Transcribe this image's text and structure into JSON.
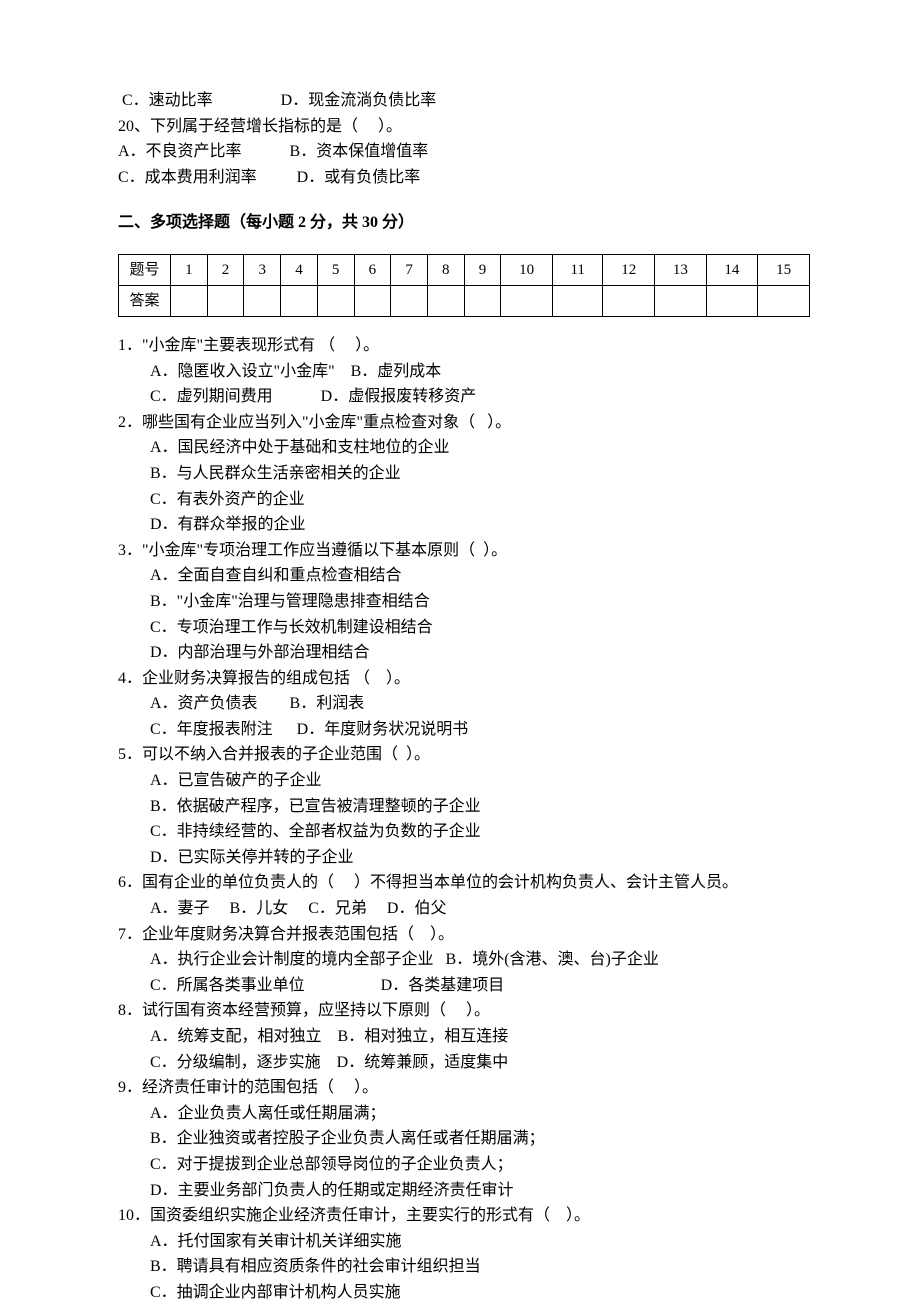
{
  "top": {
    "line1": " C．速动比率                 D．现金流淌负债比率",
    "line2": "20、下列属于经营增长指标的是（     ）。",
    "line3": "A．不良资产比率            B．资本保值增值率",
    "line4": "C．成本费用利润率          D．或有负债比率"
  },
  "section2_title": "二、多项选择题（每小题 2 分，共 30 分）",
  "table": {
    "row_label_1": "题号",
    "row_label_2": "答案",
    "numbers": [
      "1",
      "2",
      "3",
      "4",
      "5",
      "6",
      "7",
      "8",
      "9",
      "10",
      "11",
      "12",
      "13",
      "14",
      "15"
    ]
  },
  "q1": {
    "stem": "1．\"小金库\"主要表现形式有 （     ）。",
    "a": "A．隐匿收入设立\"小金库\"    B．虚列成本",
    "b": "C．虚列期间费用            D．虚假报废转移资产"
  },
  "q2": {
    "stem": "2．哪些国有企业应当列入\"小金库\"重点检查对象（   ）。",
    "a": "A．国民经济中处于基础和支柱地位的企业",
    "b": "B．与人民群众生活亲密相关的企业",
    "c": "C．有表外资产的企业",
    "d": "D．有群众举报的企业"
  },
  "q3": {
    "stem": "3．\"小金库\"专项治理工作应当遵循以下基本原则（  ）。",
    "a": "A．全面自查自纠和重点检查相结合",
    "b": "B．\"小金库\"治理与管理隐患排查相结合",
    "c": "C．专项治理工作与长效机制建设相结合",
    "d": "D．内部治理与外部治理相结合"
  },
  "q4": {
    "stem": "4．企业财务决算报告的组成包括 （    ）。",
    "a": "A．资产负债表        B．利润表",
    "b": "C．年度报表附注      D．年度财务状况说明书"
  },
  "q5": {
    "stem": "5．可以不纳入合并报表的子企业范围（  ）。",
    "a": "A．已宣告破产的子企业",
    "b": "B．依据破产程序，已宣告被清理整顿的子企业",
    "c": "C．非持续经营的、全部者权益为负数的子企业",
    "d": "D．已实际关停并转的子企业"
  },
  "q6": {
    "stem": "6．国有企业的单位负责人的（     ）不得担当本单位的会计机构负责人、会计主管人员。",
    "a": "A．妻子     B．儿女     C．兄弟     D．伯父"
  },
  "q7": {
    "stem": "7．企业年度财务决算合并报表范围包括（    ）。",
    "a": "A．执行企业会计制度的境内全部子企业   B．境外(含港、澳、台)子企业",
    "b": "C．所属各类事业单位                   D．各类基建项目"
  },
  "q8": {
    "stem": "8．试行国有资本经营预算，应坚持以下原则（     ）。",
    "a": "A．统筹支配，相对独立    B．相对独立，相互连接",
    "b": "C．分级编制，逐步实施    D．统筹兼顾，适度集中"
  },
  "q9": {
    "stem": "9．经济责任审计的范围包括（     ）。",
    "a": "A．企业负责人离任或任期届满；",
    "b": "B．企业独资或者控股子企业负责人离任或者任期届满；",
    "c": "C．对于提拔到企业总部领导岗位的子企业负责人；",
    "d": "D．主要业务部门负责人的任期或定期经济责任审计"
  },
  "q10": {
    "stem": "10．国资委组织实施企业经济责任审计，主要实行的形式有（    ）。",
    "a": "A．托付国家有关审计机关详细实施",
    "b": "B．聘请具有相应资质条件的社会审计组织担当",
    "c": "C．抽调企业内部审计机构人员实施"
  }
}
